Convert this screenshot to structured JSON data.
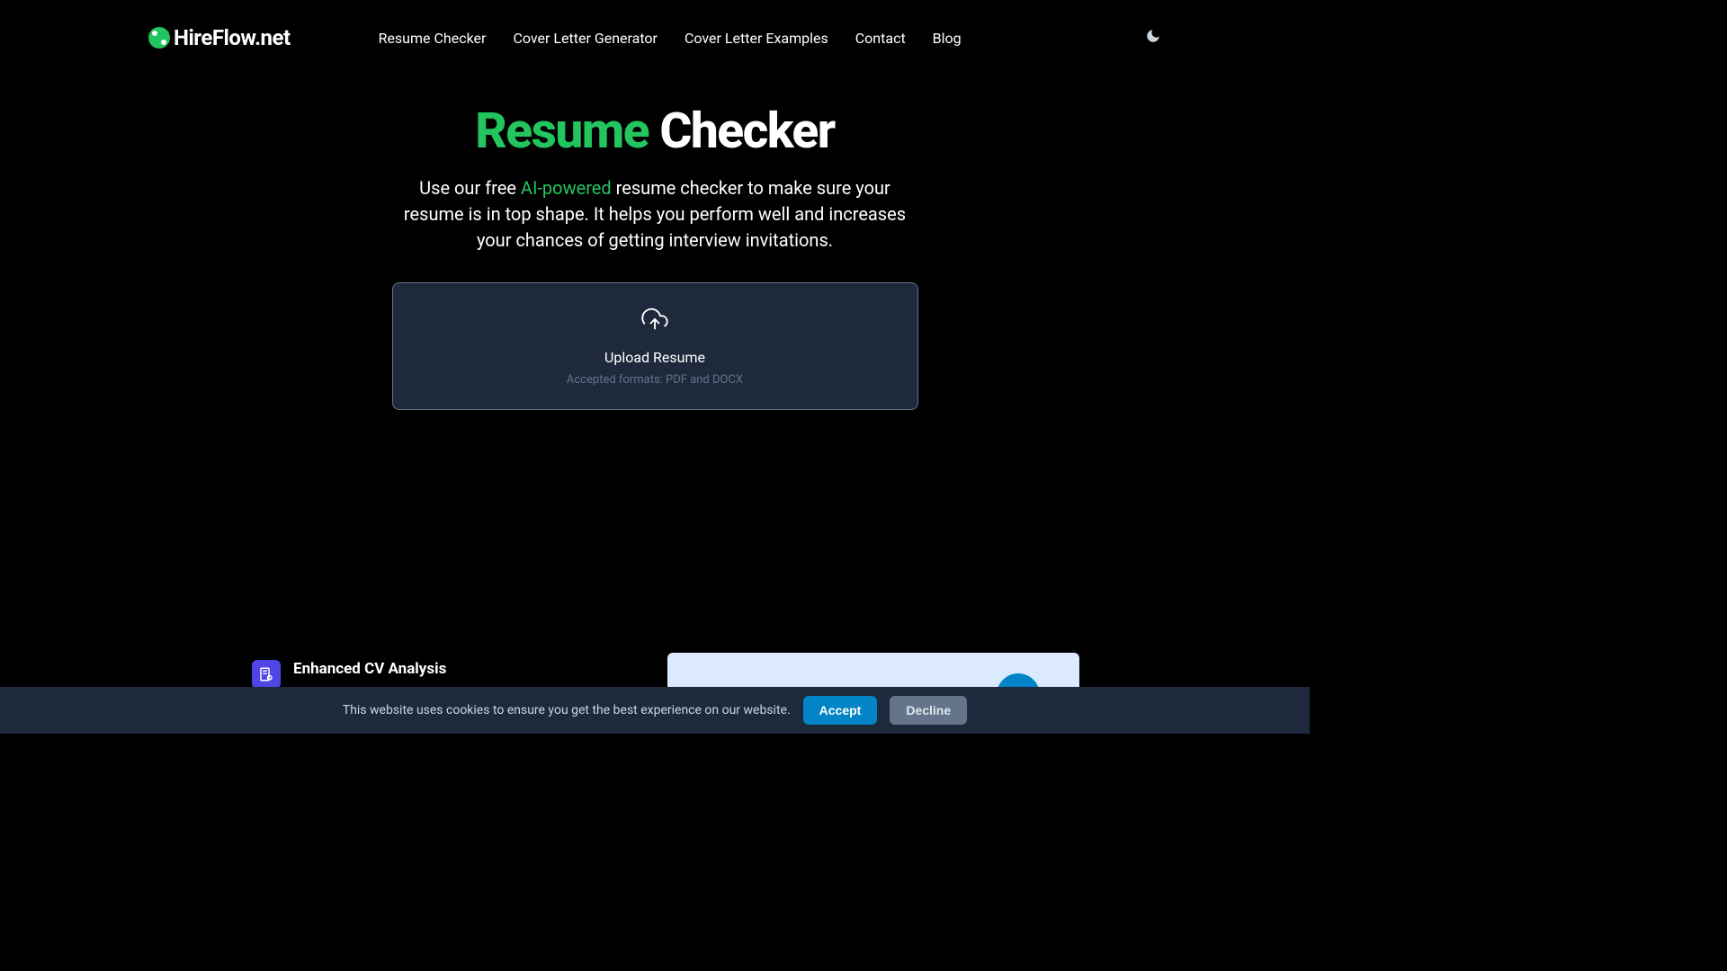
{
  "logo": {
    "hire": "Hire",
    "flow": "Flow",
    "net": ".net"
  },
  "nav": {
    "resume_checker": "Resume Checker",
    "cover_letter_generator": "Cover Letter Generator",
    "cover_letter_examples": "Cover Letter Examples",
    "contact": "Contact",
    "blog": "Blog"
  },
  "hero": {
    "title_highlight": "Resume",
    "title_rest": " Checker",
    "subtitle_prefix": "Use our free ",
    "subtitle_highlight": "AI-powered",
    "subtitle_suffix": " resume checker to make sure your resume is in top shape. It helps you perform well and increases your chances of getting interview invitations."
  },
  "upload": {
    "label": "Upload Resume",
    "formats": "Accepted formats: PDF and DOCX"
  },
  "feature": {
    "title": "Enhanced CV Analysis"
  },
  "cookie": {
    "text": "This website uses cookies to ensure you get the best experience on our website.",
    "accept": "Accept",
    "decline": "Decline"
  }
}
